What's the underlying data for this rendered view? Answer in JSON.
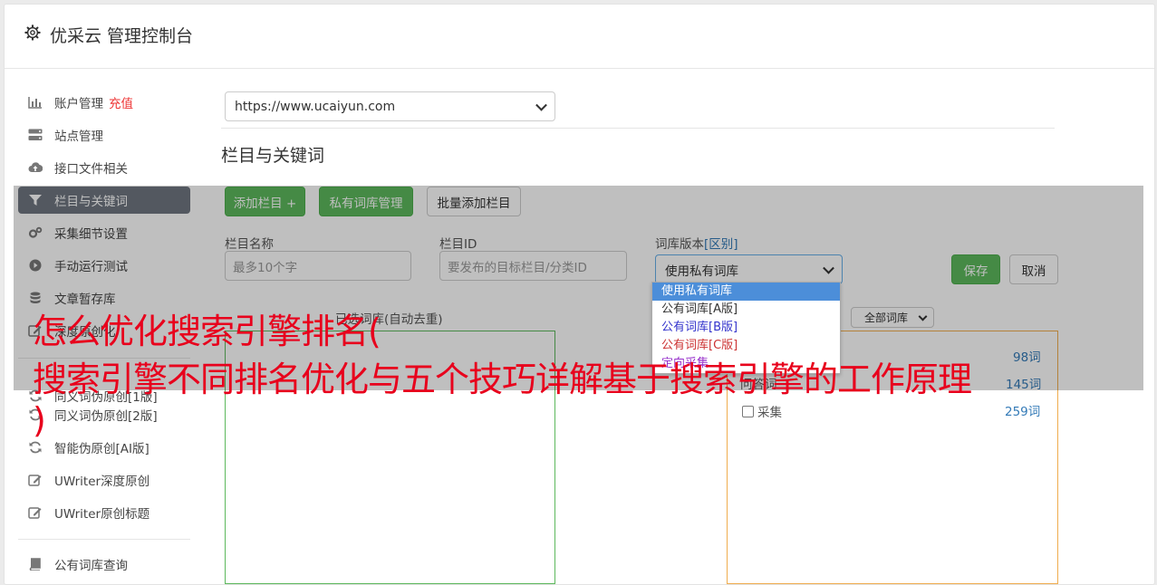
{
  "app": {
    "title": "优采云 管理控制台"
  },
  "sidebar": {
    "items": [
      {
        "label": "账户管理",
        "badge": "充值",
        "icon": "bar-chart-icon"
      },
      {
        "label": "站点管理",
        "icon": "server-icon"
      },
      {
        "label": "接口文件相关",
        "icon": "cloud-upload-icon"
      },
      {
        "label": "栏目与关键词",
        "icon": "filter-icon",
        "active": true
      },
      {
        "label": "采集细节设置",
        "icon": "cogs-icon"
      },
      {
        "label": "手动运行测试",
        "icon": "play-circle-icon"
      },
      {
        "label": "文章暂存库",
        "icon": "database-icon"
      },
      {
        "label": "深度原创化",
        "icon": "edit-icon"
      },
      {
        "label": "同义词伪原创[1版]",
        "icon": "refresh-icon"
      },
      {
        "label": "同义词伪原创[2版]",
        "icon": "refresh-icon"
      },
      {
        "label": "智能伪原创[AI版]",
        "icon": "refresh-icon"
      },
      {
        "label": "UWriter深度原创",
        "icon": "edit-icon"
      },
      {
        "label": "UWriter原创标题",
        "icon": "edit-icon"
      },
      {
        "label": "公有词库查询",
        "icon": "book-icon"
      }
    ]
  },
  "site_select": {
    "value": "https://www.ucaiyun.com"
  },
  "section": {
    "title": "栏目与关键词"
  },
  "toolbar": {
    "add_column": "添加栏目 +",
    "private_lexicon": "私有词库管理",
    "batch_add": "批量添加栏目"
  },
  "form": {
    "column_name_label": "栏目名称",
    "column_name_placeholder": "最多10个字",
    "column_id_label": "栏目ID",
    "column_id_placeholder": "要发布的目标栏目/分类ID",
    "lexicon_label": "词库版本",
    "lexicon_diff": "[区别]",
    "lexicon_value": "使用私有词库",
    "save": "保存",
    "cancel": "取消"
  },
  "lexicon_options": [
    {
      "label": "使用私有词库",
      "selected": true,
      "color": "#ffffff"
    },
    {
      "label": "公有词库[A版]",
      "color": "#333333"
    },
    {
      "label": "公有词库[B版]",
      "color": "#3333cc"
    },
    {
      "label": "公有词库[C版]",
      "color": "#cc3333"
    },
    {
      "label": "定向采集",
      "color": "#9933cc"
    }
  ],
  "keywords": {
    "selected_label": "已选词库(自动去重)",
    "filter_value": "全部词库",
    "counts": [
      "98词",
      "145词",
      "259词"
    ],
    "item_prefix": "问答词",
    "item_label": "采集"
  },
  "banner": {
    "line1": "怎么优化搜索引擎排名(",
    "line2": "搜索引擎不同排名优化与五个技巧详解基于搜索引擎的工作原理",
    "line3": ")"
  }
}
